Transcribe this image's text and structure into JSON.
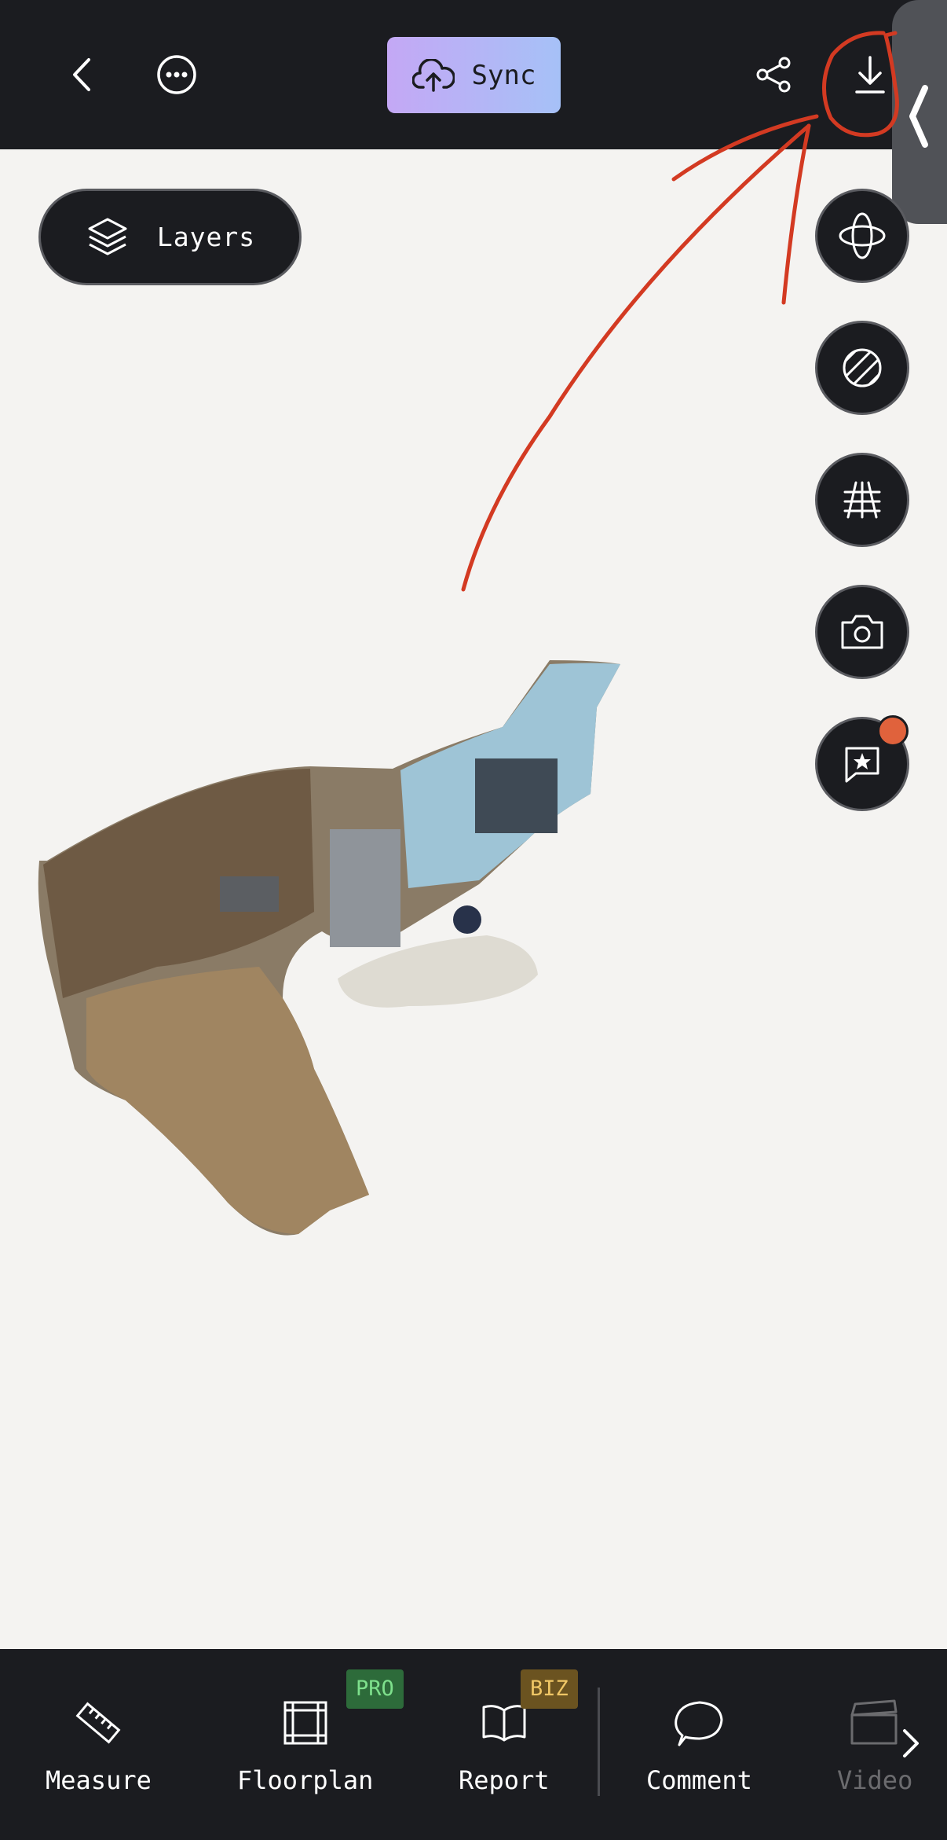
{
  "toolbar": {
    "back_icon": "chevron-left-icon",
    "more_icon": "more-dots-icon",
    "sync_label": "Sync",
    "share_icon": "share-icon",
    "download_icon": "download-icon"
  },
  "layers": {
    "label": "Layers"
  },
  "side_tools": [
    {
      "icon": "orbit-icon"
    },
    {
      "icon": "texture-toggle-icon"
    },
    {
      "icon": "perspective-grid-icon"
    },
    {
      "icon": "camera-icon"
    },
    {
      "icon": "star-comment-icon",
      "has_notification": true
    }
  ],
  "bottom_nav": {
    "items": [
      {
        "label": "Measure",
        "icon": "ruler-icon"
      },
      {
        "label": "Floorplan",
        "icon": "floorplan-icon",
        "badge": "PRO"
      },
      {
        "label": "Report",
        "icon": "book-icon",
        "badge": "BIZ"
      },
      {
        "label": "Comment",
        "icon": "speech-bubble-icon"
      },
      {
        "label": "Video",
        "icon": "clapperboard-icon"
      }
    ]
  },
  "colors": {
    "bar_bg": "#1b1c20",
    "canvas_bg": "#f4f3f1",
    "sync_gradient_start": "#c4a8f5",
    "sync_gradient_end": "#a6c1f7",
    "pro_badge": "#2d6b3a",
    "biz_badge": "#6b5320",
    "notification": "#e0623c",
    "annotation": "#d33a22"
  }
}
